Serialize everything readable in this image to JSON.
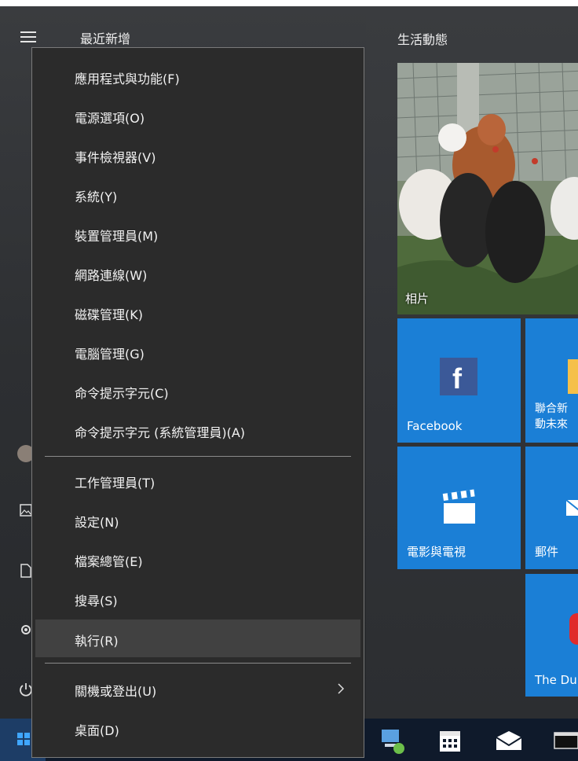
{
  "start": {
    "recent_title": "最近新增",
    "life_title": "生活動態"
  },
  "tiles": {
    "photos": "相片",
    "facebook": "Facebook",
    "news_line1": "聯合新",
    "news_line2": "動未來",
    "movies": "電影與電視",
    "mail": "郵件",
    "game": "The Du"
  },
  "menu": {
    "items": [
      "應用程式與功能(F)",
      "電源選項(O)",
      "事件檢視器(V)",
      "系統(Y)",
      "裝置管理員(M)",
      "網路連線(W)",
      "磁碟管理(K)",
      "電腦管理(G)",
      "命令提示字元(C)",
      "命令提示字元 (系統管理員)(A)",
      "工作管理員(T)",
      "設定(N)",
      "檔案總管(E)",
      "搜尋(S)",
      "執行(R)",
      "關機或登出(U)",
      "桌面(D)"
    ]
  },
  "colors": {
    "tile_blue": "#1b7fd6",
    "menu_bg": "#2b2b2b",
    "highlight": "#414141",
    "taskbar": "#0f1a2b"
  }
}
